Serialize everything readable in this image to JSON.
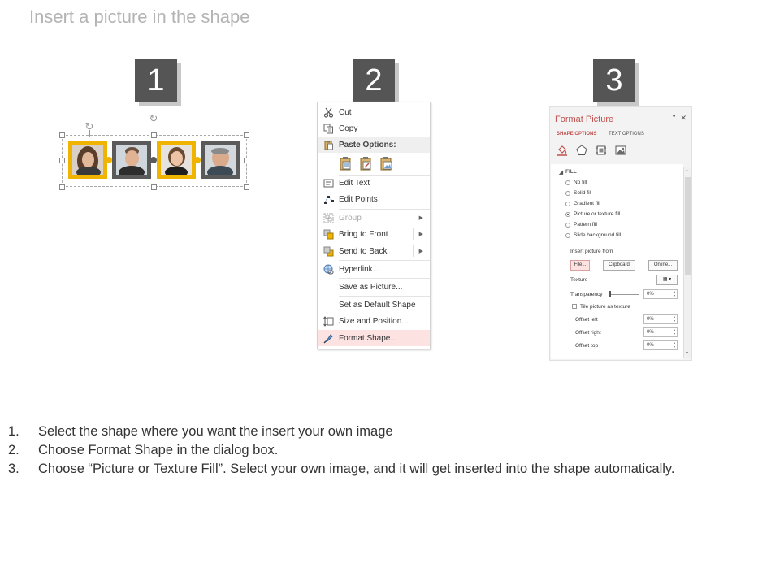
{
  "title": "Insert a picture in the shape",
  "steps_badges": [
    "1",
    "2",
    "3"
  ],
  "context_menu": {
    "items": [
      {
        "label": "Cut",
        "icon": "scissors-icon",
        "disabled": false
      },
      {
        "label": "Copy",
        "icon": "copy-icon",
        "disabled": false
      },
      {
        "label": "Paste Options:",
        "icon": "paste-icon",
        "header": true
      },
      {
        "label": "Edit Text",
        "icon": "edit-text-icon",
        "disabled": false
      },
      {
        "label": "Edit Points",
        "icon": "edit-points-icon",
        "disabled": false
      },
      {
        "label": "Group",
        "icon": "group-icon",
        "disabled": true,
        "submenu": true
      },
      {
        "label": "Bring to Front",
        "icon": "bring-to-front-icon",
        "disabled": false,
        "submenu": true
      },
      {
        "label": "Send to Back",
        "icon": "send-to-back-icon",
        "disabled": false,
        "submenu": true
      },
      {
        "label": "Hyperlink...",
        "icon": "hyperlink-icon",
        "disabled": false
      },
      {
        "label": "Save as Picture...",
        "icon": "",
        "disabled": false
      },
      {
        "label": "Set as Default Shape",
        "icon": "",
        "disabled": false
      },
      {
        "label": "Size and Position...",
        "icon": "size-position-icon",
        "disabled": false
      },
      {
        "label": "Format Shape...",
        "icon": "format-shape-icon",
        "disabled": false,
        "highlighted": true
      }
    ]
  },
  "format_pane": {
    "title": "Format Picture",
    "tab_active": "SHAPE OPTIONS",
    "tab_inactive": "TEXT OPTIONS",
    "section": "FILL",
    "fill_options": [
      {
        "label": "No fill",
        "selected": false
      },
      {
        "label": "Solid fill",
        "selected": false
      },
      {
        "label": "Gradient fill",
        "selected": false
      },
      {
        "label": "Picture or texture fill",
        "selected": true
      },
      {
        "label": "Pattern fill",
        "selected": false
      },
      {
        "label": "Slide background fill",
        "selected": false
      }
    ],
    "insert_from_label": "Insert picture from",
    "buttons": {
      "file": "File...",
      "clipboard": "Clipboard",
      "online": "Online..."
    },
    "texture_label": "Texture",
    "transparency_label": "Transparency",
    "transparency_value": "0%",
    "tile_label": "Tile picture as texture",
    "offset_left_label": "Offset left",
    "offset_left_value": "0%",
    "offset_right_label": "Offset right",
    "offset_right_value": "0%",
    "offset_top_label": "Offset top",
    "offset_top_value": "0%"
  },
  "instructions": [
    {
      "n": "1.",
      "text": "Select the shape where you want the insert your own image"
    },
    {
      "n": "2.",
      "text": "Choose Format Shape in the dialog box."
    },
    {
      "n": "3.",
      "text": "Choose “Picture or Texture Fill”. Select your own image, and it will get inserted into the shape automatically."
    }
  ],
  "colors": {
    "accent": "#c0504d",
    "badge": "#555555",
    "frame_yellow": "#f0b400",
    "frame_gray": "#5a5a5a"
  }
}
